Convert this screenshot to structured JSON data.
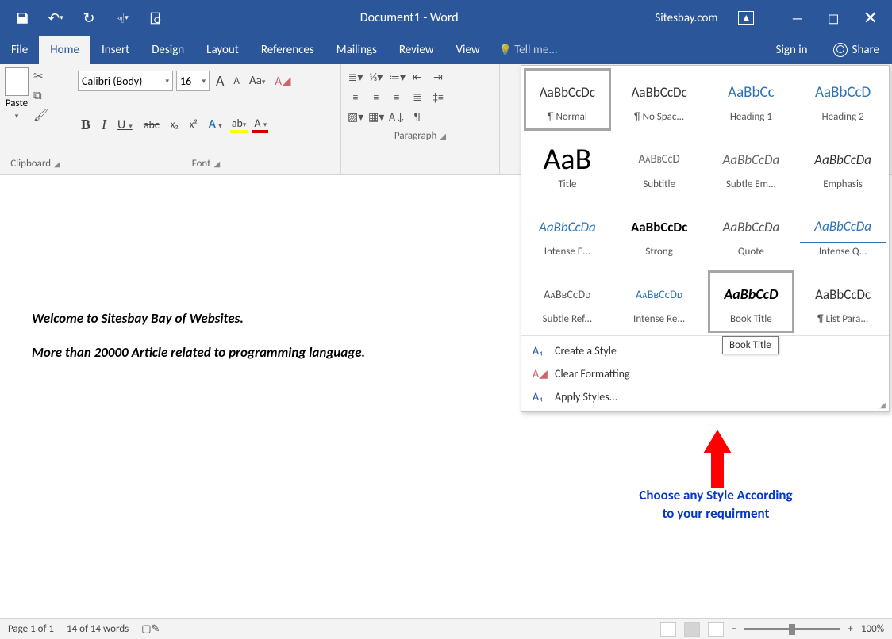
{
  "titlebar": {
    "doc_title": "Document1 - Word",
    "site": "Sitesbay.com"
  },
  "menu": {
    "file": "File",
    "home": "Home",
    "insert": "Insert",
    "design": "Design",
    "layout": "Layout",
    "references": "References",
    "mailings": "Mailings",
    "review": "Review",
    "view": "View",
    "tell_me": "Tell me...",
    "sign_in": "Sign in",
    "share": "Share"
  },
  "ribbon": {
    "clipboard": {
      "paste": "Paste",
      "label": "Clipboard"
    },
    "font": {
      "name": "Calibri (Body)",
      "size": "16",
      "label": "Font",
      "grow": "A",
      "shrink": "A",
      "case": "Aa",
      "clear": "A",
      "bold": "B",
      "italic": "I",
      "underline": "U",
      "strike": "abc",
      "sub": "x₂",
      "sup": "x²",
      "effects": "A",
      "highlight": "ab",
      "color": "A"
    },
    "paragraph": {
      "label": "Paragraph"
    }
  },
  "document": {
    "line1": "Welcome to Sitesbay Bay of Websites.",
    "line2": "More than 20000 Article related to programming language."
  },
  "styles_gallery": {
    "items": [
      {
        "preview": "AaBbCcDc",
        "label": "¶ Normal",
        "cls": "prev-normal",
        "selected": true
      },
      {
        "preview": "AaBbCcDc",
        "label": "¶ No Spac...",
        "cls": "prev-normal"
      },
      {
        "preview": "AaBbCc",
        "label": "Heading 1",
        "cls": "prev-heading"
      },
      {
        "preview": "AaBbCcD",
        "label": "Heading 2",
        "cls": "prev-heading"
      },
      {
        "preview": "AaB",
        "label": "Title",
        "cls": "prev-title"
      },
      {
        "preview": "AaBbCcD",
        "label": "Subtitle",
        "cls": "prev-subtitle"
      },
      {
        "preview": "AaBbCcDa",
        "label": "Subtle Em...",
        "cls": "prev-subtle-em"
      },
      {
        "preview": "AaBbCcDa",
        "label": "Emphasis",
        "cls": "prev-emph"
      },
      {
        "preview": "AaBbCcDa",
        "label": "Intense E...",
        "cls": "prev-intense-e"
      },
      {
        "preview": "AaBbCcDc",
        "label": "Strong",
        "cls": "prev-strong"
      },
      {
        "preview": "AaBbCcDa",
        "label": "Quote",
        "cls": "prev-quote"
      },
      {
        "preview": "AaBbCcDa",
        "label": "Intense Q...",
        "cls": "prev-intense-q"
      },
      {
        "preview": "AᴀBʙCᴄDᴅ",
        "label": "Subtle Ref...",
        "cls": "prev-subtle-ref"
      },
      {
        "preview": "AᴀBʙCᴄDᴅ",
        "label": "Intense Re...",
        "cls": "prev-intense-re"
      },
      {
        "preview": "AaBbCcD",
        "label": "Book Title",
        "cls": "prev-book-title",
        "hover": true
      },
      {
        "preview": "AaBbCcDc",
        "label": "¶ List Para...",
        "cls": "prev-normal"
      }
    ],
    "create_style": "Create a Style",
    "clear_formatting": "Clear Formatting",
    "apply_styles": "Apply Styles...",
    "tooltip": "Book Title"
  },
  "annotation": {
    "line1": "Choose any Style According",
    "line2": "to your requirment"
  },
  "status": {
    "page": "Page 1 of 1",
    "words": "14 of 14 words",
    "zoom": "100%"
  }
}
